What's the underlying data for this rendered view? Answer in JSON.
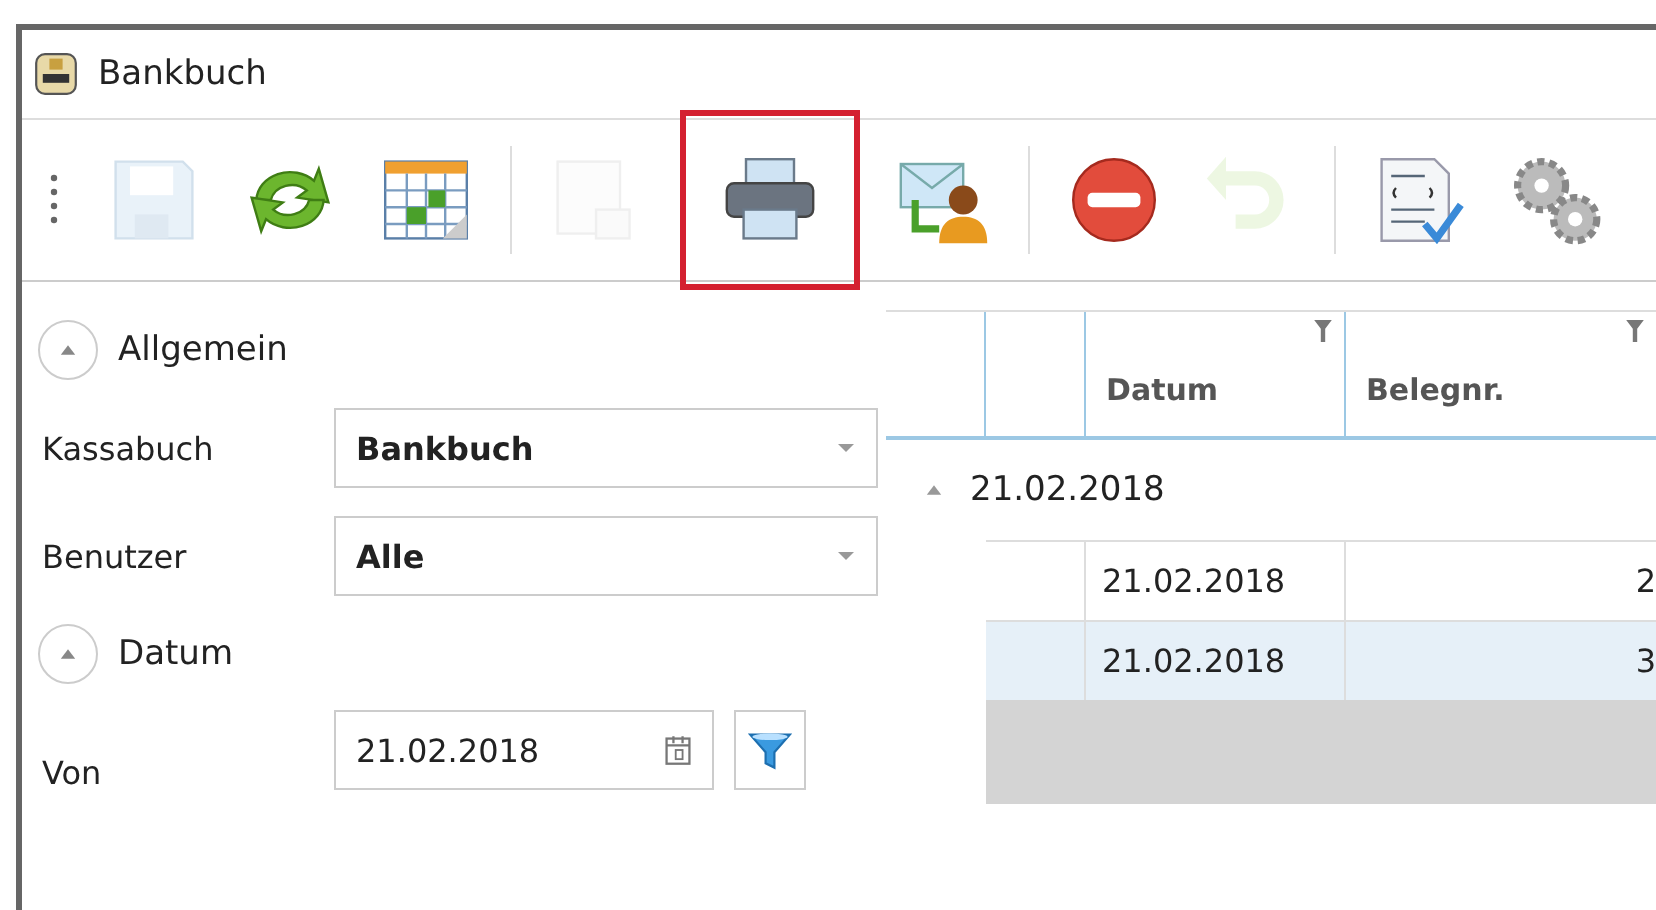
{
  "window": {
    "title": "Bankbuch"
  },
  "toolbar": [
    {
      "kind": "save",
      "disabled": true,
      "highlighted": false
    },
    {
      "kind": "refresh",
      "disabled": false,
      "highlighted": false
    },
    {
      "kind": "calendar",
      "disabled": false,
      "highlighted": false
    },
    {
      "kind": "separator"
    },
    {
      "kind": "export",
      "disabled": true,
      "highlighted": false
    },
    {
      "kind": "print",
      "disabled": false,
      "highlighted": true
    },
    {
      "kind": "mail",
      "disabled": false,
      "highlighted": false
    },
    {
      "kind": "separator"
    },
    {
      "kind": "delete",
      "disabled": false,
      "highlighted": false
    },
    {
      "kind": "undo",
      "disabled": true,
      "highlighted": false
    },
    {
      "kind": "separator"
    },
    {
      "kind": "document",
      "disabled": false,
      "highlighted": false
    },
    {
      "kind": "settings",
      "disabled": false,
      "highlighted": false
    }
  ],
  "filters": [
    {
      "title": "Allgemein",
      "expanded": true,
      "fields": [
        {
          "label": "Kassabuch",
          "value": "Bankbuch",
          "kind": "dropdown",
          "bold": true
        },
        {
          "label": "Benutzer",
          "value": "Alle",
          "kind": "dropdown",
          "bold": true
        }
      ]
    },
    {
      "title": "Datum",
      "expanded": true,
      "fields": [
        {
          "label": "Von",
          "value": "21.02.2018",
          "kind": "date",
          "bold": false
        }
      ]
    }
  ],
  "table": {
    "columns": [
      {},
      {},
      {
        "label": "Datum"
      },
      {
        "label": "Belegnr."
      }
    ],
    "group": {
      "label": "21.02.2018",
      "expanded": true
    },
    "rows": [
      {
        "selected": false,
        "cells": [
          "",
          "",
          "21.02.2018",
          "2"
        ]
      },
      {
        "selected": true,
        "cells": [
          "",
          "",
          "21.02.2018",
          "3"
        ]
      }
    ]
  }
}
